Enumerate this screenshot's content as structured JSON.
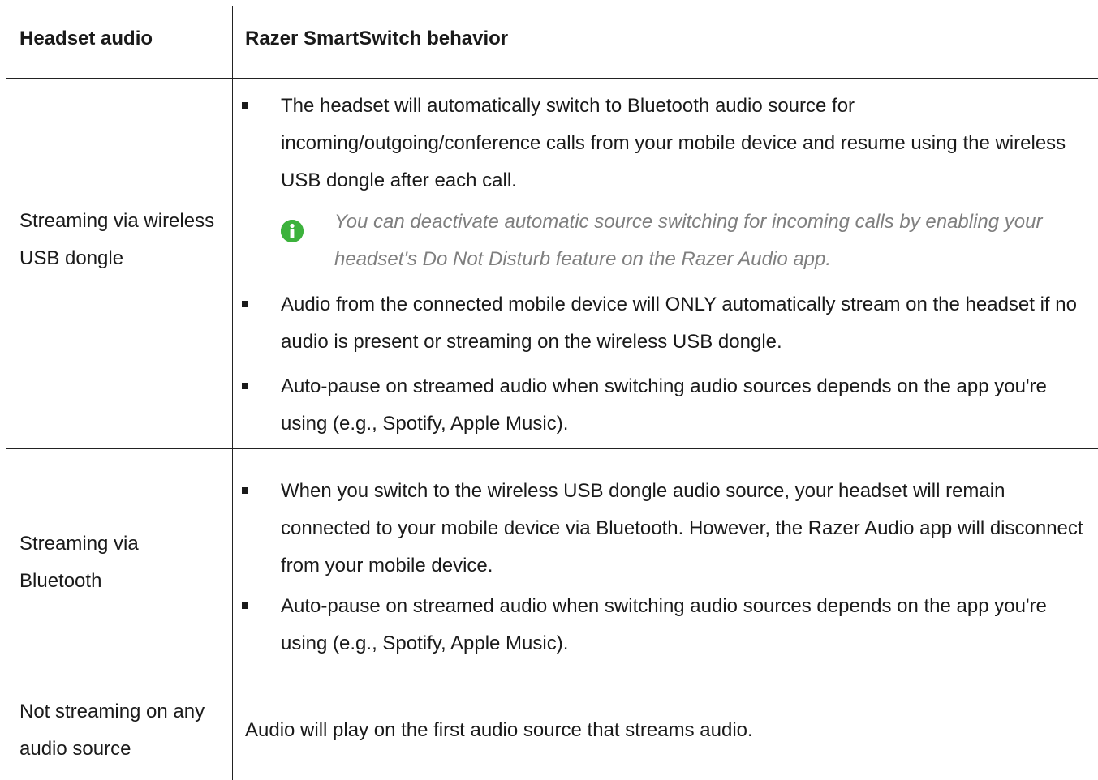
{
  "header": {
    "col1": "Headset audio",
    "col2": "Razer SmartSwitch behavior"
  },
  "rows": [
    {
      "label": "Streaming via wireless USB dongle",
      "bullets": [
        "The headset will automatically switch to Bluetooth audio source for incoming/outgoing/conference calls from your mobile device and resume using the wireless USB dongle after each call.",
        "Audio from the connected mobile device will ONLY automatically stream on the headset if no audio is present or streaming on the wireless USB dongle.",
        "Auto-pause on streamed audio when switching audio sources depends on the app you're using (e.g., Spotify, Apple Music)."
      ],
      "note": "You can deactivate automatic source switching for incoming calls by enabling your headset's Do Not Disturb feature on the Razer Audio app.",
      "note_icon": "info-icon",
      "note_icon_color": "#3cb23c"
    },
    {
      "label": "Streaming via Bluetooth",
      "bullets": [
        "When you switch to the wireless USB dongle audio source, your headset will remain connected to your mobile device via Bluetooth. However, the Razer Audio app will disconnect from your mobile device.",
        "Auto-pause on streamed audio when switching audio sources depends on the app you're using (e.g., Spotify, Apple Music)."
      ]
    },
    {
      "label": "Not streaming on any audio source",
      "text": "Audio will play on the first audio source that streams audio."
    }
  ]
}
